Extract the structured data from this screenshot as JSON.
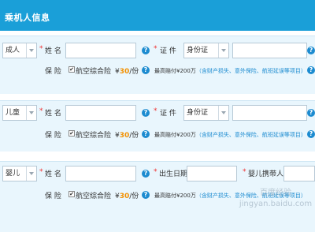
{
  "header": {
    "title": "乘机人信息"
  },
  "labels": {
    "name": "姓  名",
    "cert": "证  件",
    "insurance": "保  险",
    "birth": "出生日期",
    "guardian": "婴儿携带人",
    "required": "*",
    "help": "?"
  },
  "passengers": [
    {
      "type": "成人",
      "cert_type": "身份证",
      "insurance_name": "航空综合险",
      "checked": "✔",
      "price_prefix": "¥",
      "price_num": "30",
      "price_suffix": "/份",
      "note_prefix": "最高赔付¥200万",
      "note_link": "（含财产损失、意外保险、航班延误等项目）"
    },
    {
      "type": "儿童",
      "cert_type": "身份证",
      "insurance_name": "航空综合险",
      "checked": "✔",
      "price_prefix": "¥",
      "price_num": "30",
      "price_suffix": "/份",
      "note_prefix": "最高赔付¥200万",
      "note_link": "（含财产损失、意外保险、航班延误等项目）"
    },
    {
      "type": "婴儿",
      "insurance_name": "航空综合险",
      "checked": "✔",
      "price_prefix": "¥",
      "price_num": "30",
      "price_suffix": "/份",
      "note_prefix": "最高赔付¥200万",
      "note_link": "（含财产损失、意外保险、航班延误等项目）"
    }
  ],
  "watermark": "百度经验 jingyan.baidu.com",
  "colors": {
    "header_bg": "#1a9fd8",
    "section_bg": "#e9f6fd",
    "price": "#f29000",
    "link": "#1c8bd0",
    "required": "#e33333"
  }
}
